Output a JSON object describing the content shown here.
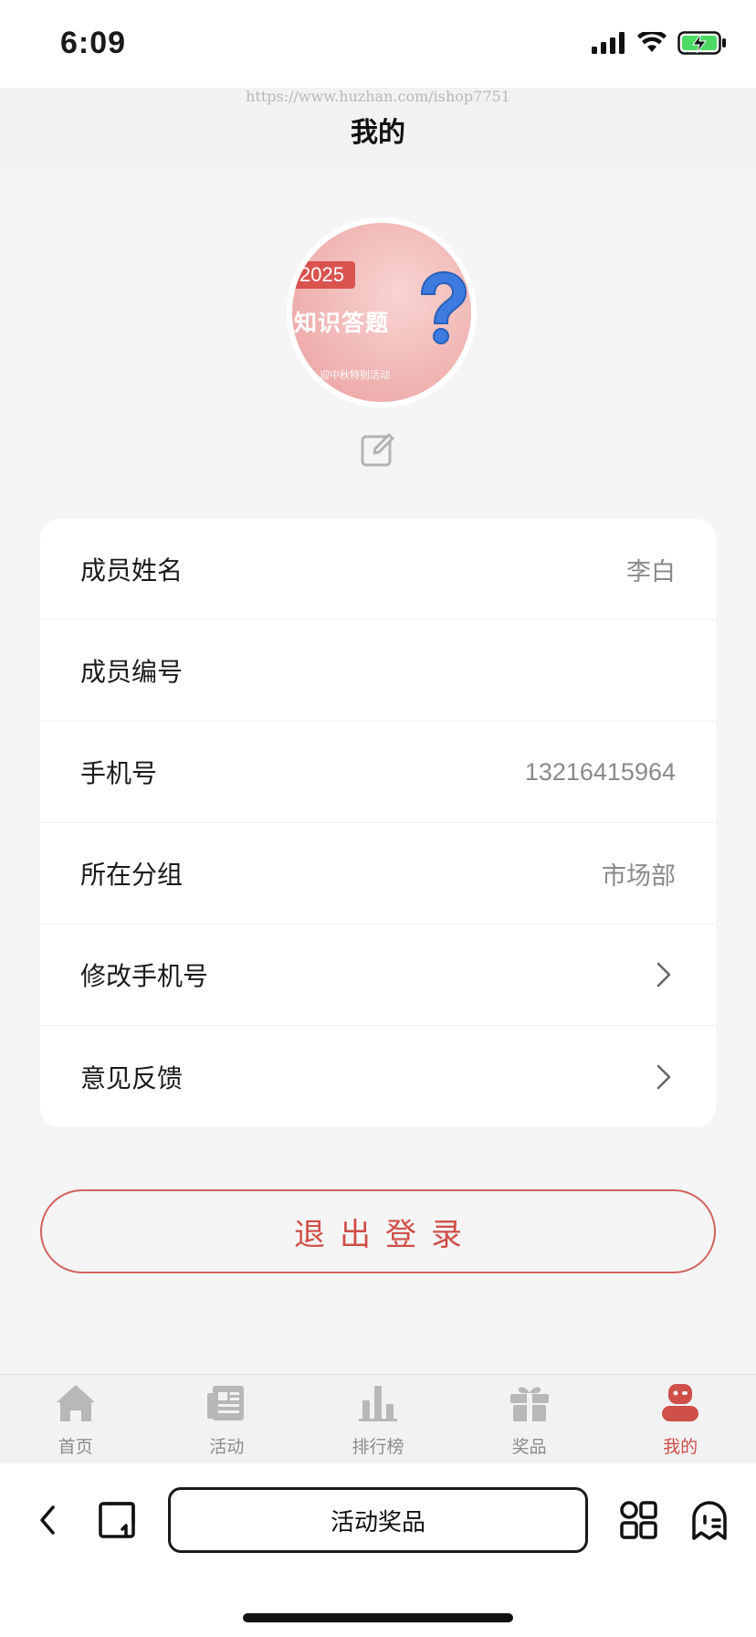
{
  "status_bar": {
    "time": "6:09"
  },
  "header": {
    "url": "https://www.huzhan.com/ishop7751",
    "title": "我的"
  },
  "avatar": {
    "year": "2025",
    "title": "知识答题",
    "subtitle": "迎中秋特别活动"
  },
  "profile_rows": [
    {
      "label": "成员姓名",
      "value": "李白"
    },
    {
      "label": "成员编号",
      "value": ""
    },
    {
      "label": "手机号",
      "value": "13216415964"
    },
    {
      "label": "所在分组",
      "value": "市场部"
    },
    {
      "label": "修改手机号"
    },
    {
      "label": "意见反馈"
    }
  ],
  "logout_label": "退出登录",
  "tabs": [
    {
      "label": "首页",
      "icon": "home-icon"
    },
    {
      "label": "活动",
      "icon": "news-icon"
    },
    {
      "label": "排行榜",
      "icon": "ranking-icon"
    },
    {
      "label": "奖品",
      "icon": "gift-icon"
    },
    {
      "label": "我的",
      "icon": "user-icon",
      "active": true
    }
  ],
  "browser": {
    "address": "活动奖品"
  },
  "colors": {
    "accent": "#cf4f49",
    "inactive": "#b8b8b8",
    "background": "#f5f5f5"
  }
}
